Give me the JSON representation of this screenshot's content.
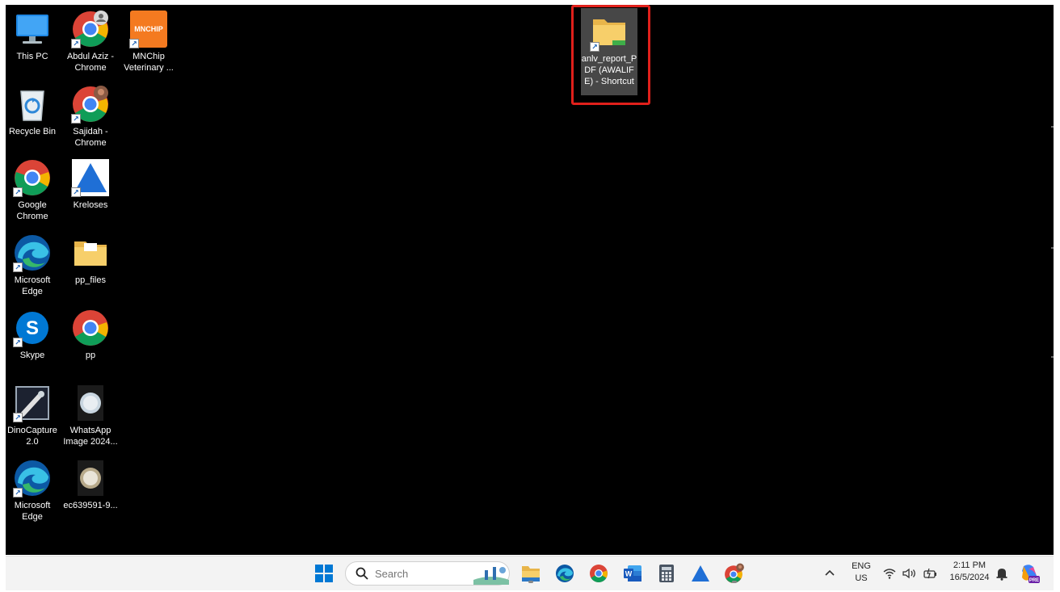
{
  "desktop": {
    "icons": [
      {
        "label": "This PC",
        "icon": "this-pc-icon"
      },
      {
        "label": "Abdul Aziz - Chrome",
        "icon": "chrome-profile-icon"
      },
      {
        "label": "MNChip Veterinary ...",
        "icon": "mnchip-icon",
        "badge": "MNCHIP"
      },
      {
        "label": "Recycle Bin",
        "icon": "recycle-bin-icon"
      },
      {
        "label": "Sajidah - Chrome",
        "icon": "chrome-profile-icon"
      },
      {
        "label": "Google Chrome",
        "icon": "chrome-icon"
      },
      {
        "label": "Kreloses",
        "icon": "kreloses-icon"
      },
      {
        "label": "Microsoft Edge",
        "icon": "edge-icon"
      },
      {
        "label": "pp_files",
        "icon": "folder-icon"
      },
      {
        "label": "Skype",
        "icon": "skype-icon",
        "letter": "S"
      },
      {
        "label": "pp",
        "icon": "chrome-icon"
      },
      {
        "label": "DinoCapture 2.0",
        "icon": "dinocapture-icon"
      },
      {
        "label": "WhatsApp Image 2024...",
        "icon": "image-thumbnail-icon"
      },
      {
        "label": "Microsoft Edge",
        "icon": "edge-icon"
      },
      {
        "label": "ec639591-9...",
        "icon": "image-thumbnail-icon"
      }
    ],
    "selected_shortcut": {
      "label": "anlv_report_PDF (AWALIFE) - Shortcut",
      "icon": "folder-shortcut-icon"
    }
  },
  "taskbar": {
    "search": {
      "placeholder": "Search"
    },
    "apps": [
      "start-icon",
      "widgets-icon",
      "file-explorer-icon",
      "edge-icon",
      "chrome-icon",
      "word-icon",
      "calculator-icon",
      "kreloses-icon",
      "chrome-profile-icon"
    ],
    "tray": {
      "language": "ENG",
      "region": "US",
      "time": "2:11 PM",
      "date": "16/5/2024"
    }
  },
  "colors": {
    "desktop_bg": "#000000",
    "taskbar_bg": "#f3f3f3",
    "highlight": "#e0201b"
  }
}
